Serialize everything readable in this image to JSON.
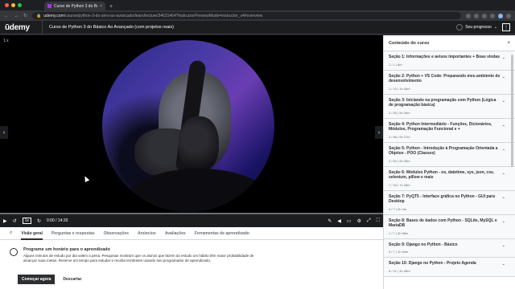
{
  "browser": {
    "tab_title": "Curso de Python 3 do Básico Ao...",
    "tab_close": "×",
    "new_tab": "+",
    "url_host": "udemy.com",
    "url_path": "/course/python-3-do-zero-ao-avancado/learn/lecture/34631464?instructorPreviewMode=instructor_v4#overview",
    "traffic_colors": [
      "#ff5f57",
      "#febc2e",
      "#28c840"
    ]
  },
  "header": {
    "logo": "ūdemy",
    "course_title": "Curso de Python 3 do Básico Ao Avançado (com projetos reais)",
    "progress_label": "Seu progresso",
    "menu_icon": "⋮"
  },
  "player": {
    "top_label": "1.x",
    "prev_arrow": "‹",
    "next_arrow": "›",
    "progress_fraction": 0,
    "controls": {
      "play": "▶",
      "rewind": "↺",
      "speed": "1x",
      "forward": "↻",
      "timecode": "0:00 / 14:20",
      "notes": "✎",
      "volume": "◀",
      "captions": "▭",
      "settings": "⚙",
      "expand": "⤢",
      "fullscreen": "⛶"
    }
  },
  "tabs": {
    "search_icon": "⌕",
    "items": [
      "Visão geral",
      "Perguntas e respostas",
      "Observações",
      "Anúncios",
      "Avaliações",
      "Ferramentas de aprendizado"
    ]
  },
  "reminder": {
    "title": "Programe um horário para o aprendizado",
    "description": "Alguns minutos de estudo por dia valem a pena. Pesquisas mostram que os alunos que fazem do estudo um hábito têm maior probabilidade de alcançar suas metas. Reserve um tempo para estudar e receba lembretes usando seu programador de aprendizado.",
    "primary_button": "Começar agora",
    "secondary_button": "Descartar"
  },
  "sidebar": {
    "title": "Conteúdo do curso",
    "close": "×",
    "chevron": "⌄",
    "sections": [
      {
        "title": "Seção 1: Informações e avisos importantes + Boas vindas",
        "meta": "1 / 1 | 8m"
      },
      {
        "title": "Seção 2: Python + VS Code: Preparando meu ambiente de desenvolvimento",
        "meta": "1 / 10 | 1h 46m"
      },
      {
        "title": "Seção 3: Iniciando na programação com Python (Lógica de programação básica)",
        "meta": "3 / 80 | 9h 39m"
      },
      {
        "title": "Seção 4: Python Intermediário - Funções, Dicionários, Módulos, Programação Funcional e +",
        "meta": "3 / 86 | 9h 27m"
      },
      {
        "title": "Seção 5: Python - Introdução à Programação Orientada a Objetos - POO (Classes)",
        "meta": "3 / 82 | 9h 35m"
      },
      {
        "title": "Seção 6: Módulos Python - os, datetime, sys, json, csv, selenium, pillow e mais",
        "meta": "7 / 34 | 7h 28m"
      },
      {
        "title": "Seção 7: PyQT5 - Interface gráfica no Python - GUI para Desktop",
        "meta": "4 / 7 | 2h 4m"
      },
      {
        "title": "Seção 8: Bases de dados com Python - SQLite, MySQL e MariaDB",
        "meta": "1 / 7 | 3h 58m"
      },
      {
        "title": "Seção 9: Django no Python - Básico",
        "meta": "3 / 7 | 1h 54m"
      },
      {
        "title": "Seção 10: Django no Python - Projeto Agenda",
        "meta": "8 / 21 | 4h 46m"
      }
    ]
  }
}
